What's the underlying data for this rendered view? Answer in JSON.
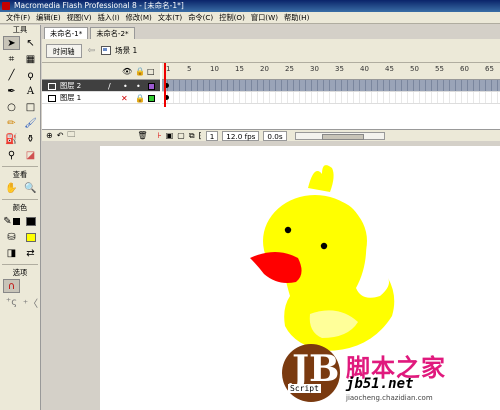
{
  "window": {
    "title": "Macromedia Flash Professional 8 - [未命名-1*]"
  },
  "menu": [
    "文件(F)",
    "编辑(E)",
    "视图(V)",
    "插入(I)",
    "修改(M)",
    "文本(T)",
    "命令(C)",
    "控制(O)",
    "窗口(W)",
    "帮助(H)"
  ],
  "tools": {
    "title": "工具",
    "view_label": "查看",
    "colors_label": "颜色",
    "options_label": "选项"
  },
  "tabs": [
    "未命名-1*",
    "未命名-2*"
  ],
  "timeline": {
    "button": "时间轴",
    "scene": "场景 1",
    "ticks": [
      "1",
      "5",
      "10",
      "15",
      "20",
      "25",
      "30",
      "35",
      "40",
      "45",
      "50",
      "55",
      "60",
      "65"
    ],
    "layers": [
      {
        "name": "图层 2",
        "selected": true,
        "color": "#9b59d0"
      },
      {
        "name": "图层 1",
        "selected": false,
        "color": "#33cc33"
      }
    ],
    "frame": "1",
    "fps": "12.0 fps",
    "time": "0.0s"
  },
  "colors": {
    "fill": "#ffff00",
    "stroke": "#000000"
  },
  "watermark": {
    "logo": "JB",
    "script": "Script",
    "cn": "脚本之家",
    "url": "jb51.net",
    "domain": "jiaocheng.chazidian.com"
  }
}
